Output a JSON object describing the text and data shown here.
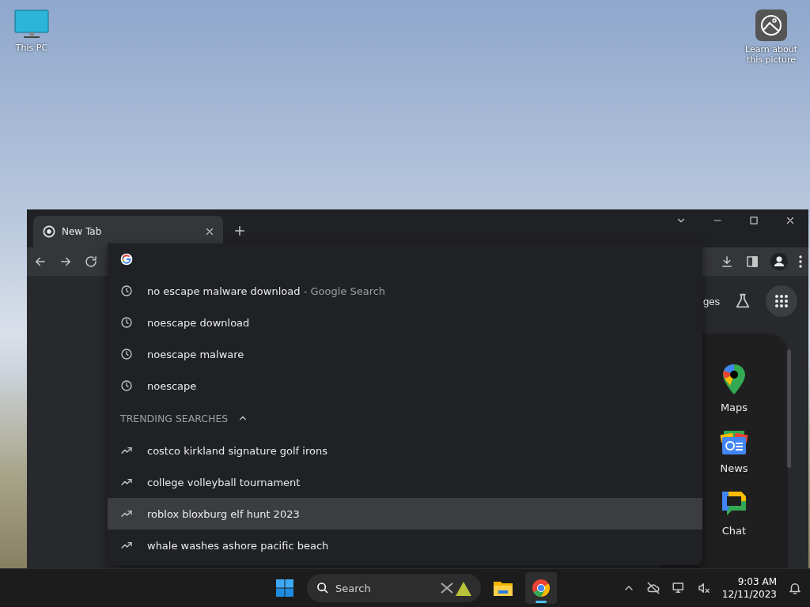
{
  "desktop_icons": [
    {
      "kind": "computer",
      "label": "This PC"
    },
    {
      "kind": "picture-info",
      "label": "Learn about this picture"
    }
  ],
  "browser": {
    "tabs": [
      {
        "title": "New Tab",
        "selected": true
      }
    ],
    "omnibox": {
      "suggestions": [
        {
          "text": "no escape malware download",
          "suffix": "- Google Search",
          "selected": false
        },
        {
          "text": "noescape download",
          "selected": false
        },
        {
          "text": "noescape malware",
          "selected": false
        },
        {
          "text": "noescape",
          "selected": false
        }
      ],
      "trending": {
        "title": "TRENDING SEARCHES",
        "expanded": true,
        "items": [
          {
            "text": "costco kirkland signature golf irons",
            "selected": false
          },
          {
            "text": "college volleyball tournament",
            "selected": false
          },
          {
            "text": "roblox bloxburg elf hunt 2023",
            "selected": true
          },
          {
            "text": "whale washes ashore pacific beach",
            "selected": false
          }
        ]
      }
    },
    "new_tab_page": {
      "header_link": "ges",
      "apps": [
        {
          "kind": "maps",
          "label": "Maps"
        },
        {
          "kind": "news",
          "label": "News"
        },
        {
          "kind": "chat",
          "label": "Chat"
        }
      ]
    }
  },
  "taskbar": {
    "search": {
      "placeholder": "Search"
    },
    "apps": [
      {
        "kind": "explorer",
        "active": false
      },
      {
        "kind": "chrome",
        "active": true
      }
    ],
    "time": "9:03 AM",
    "date": "12/11/2023"
  }
}
